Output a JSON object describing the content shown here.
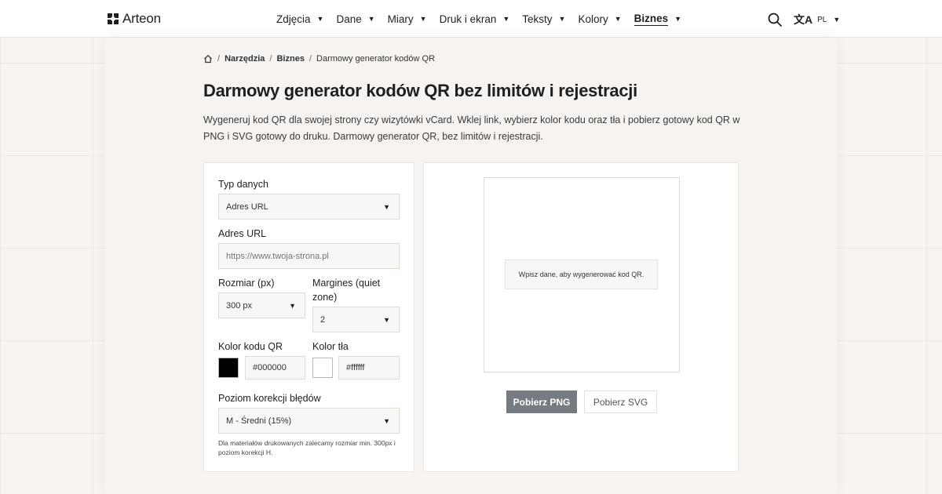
{
  "brand": {
    "name": "Arteon"
  },
  "nav": {
    "items": [
      {
        "label": "Zdjęcia"
      },
      {
        "label": "Dane"
      },
      {
        "label": "Miary"
      },
      {
        "label": "Druk i ekran"
      },
      {
        "label": "Teksty"
      },
      {
        "label": "Kolory"
      },
      {
        "label": "Biznes"
      }
    ],
    "active": "Biznes",
    "caret_glyph": "▼"
  },
  "header": {
    "search_icon": "search-icon",
    "language_icon": "translate-icon",
    "language": "PL"
  },
  "breadcrumb": {
    "home_icon": "home-icon",
    "items": [
      "Narzędzia",
      "Biznes",
      "Darmowy generator kodów QR"
    ],
    "separator": "/"
  },
  "page": {
    "title": "Darmowy generator kodów QR bez limitów i rejestracji",
    "lead": "Wygeneruj kod QR dla swojej strony czy wizytówki vCard. Wklej link, wybierz kolor kodu oraz tła i pobierz gotowy kod QR w PNG i SVG gotowy do druku. Darmowy generator QR, bez limitów i rejestracji."
  },
  "form": {
    "data_type": {
      "label": "Typ danych",
      "value": "Adres URL"
    },
    "url": {
      "label": "Adres URL",
      "placeholder": "https://www.twoja-strona.pl"
    },
    "size": {
      "label": "Rozmiar (px)",
      "value": "300 px"
    },
    "margin": {
      "label": "Margines (quiet zone)",
      "value": "2"
    },
    "qr_color": {
      "label": "Kolor kodu QR",
      "value": "#000000"
    },
    "bg_color": {
      "label": "Kolor tła",
      "value": "#ffffff"
    },
    "error_correction": {
      "label": "Poziom korekcji błędów",
      "value": "M - Średni (15%)"
    },
    "hint": "Dla materiałów drukowanych zalecamy rozmiar min. 300px i poziom korekcji H."
  },
  "preview": {
    "empty_message": "Wpisz dane, aby wygenerować kod QR.",
    "download_png": "Pobierz PNG",
    "download_svg": "Pobierz SVG"
  },
  "colors": {
    "page_bg": "#f7f4f1",
    "primary_button": "#767b82",
    "text": "#1f1f1f"
  }
}
